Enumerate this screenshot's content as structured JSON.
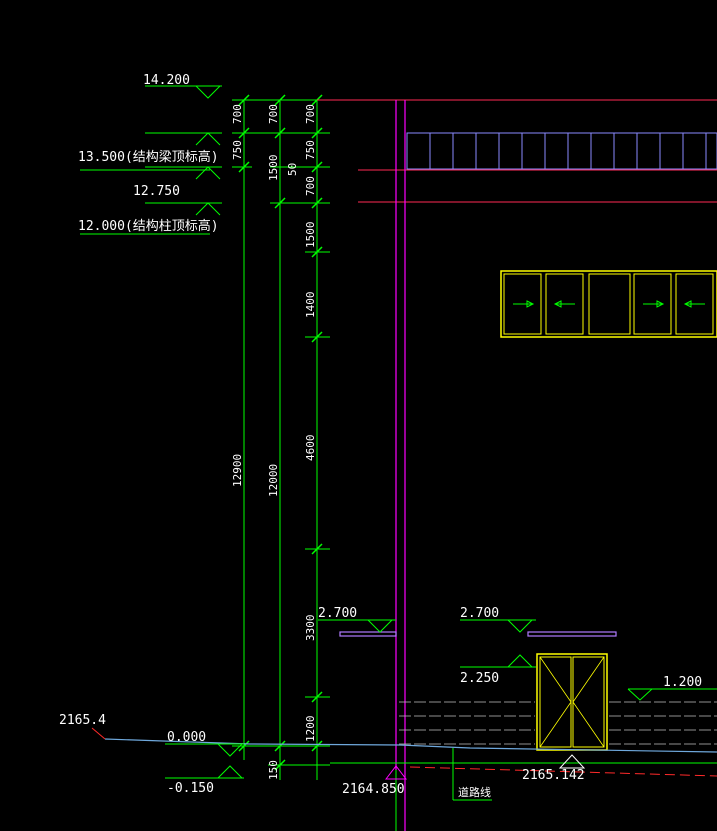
{
  "colors": {
    "background": "#000000",
    "dimension": "#00ff00",
    "wall": "#ff00ff",
    "red_line": "#ff2a2a",
    "window": "#ffff00",
    "text": "#ffffff",
    "canopy": "#b07cff",
    "brick": "#bfbfbf",
    "ground": "#6fa8dc"
  },
  "elevations": {
    "top": "14.200",
    "beam_top": "13.500(结构梁顶标高)",
    "mid": "12.750",
    "column_top": "12.000(结构柱顶标高)",
    "site": "2165.4",
    "zero": "0.000",
    "minus": "-0.150",
    "base_point": "2164.850",
    "right_point": "2165.142",
    "canopy_left": "2.700",
    "canopy_right": "2.700",
    "door_top": "2.250",
    "sill": "1.200"
  },
  "dimensions": {
    "chain_a": [
      "700",
      "750",
      "12900"
    ],
    "chain_b": [
      "700",
      "1500",
      "12000",
      "150"
    ],
    "chain_c": [
      "700",
      "750",
      "50",
      "700",
      "1500",
      "1400",
      "4600",
      "3300",
      "1200"
    ]
  },
  "notes": {
    "road_line": "道路线"
  }
}
